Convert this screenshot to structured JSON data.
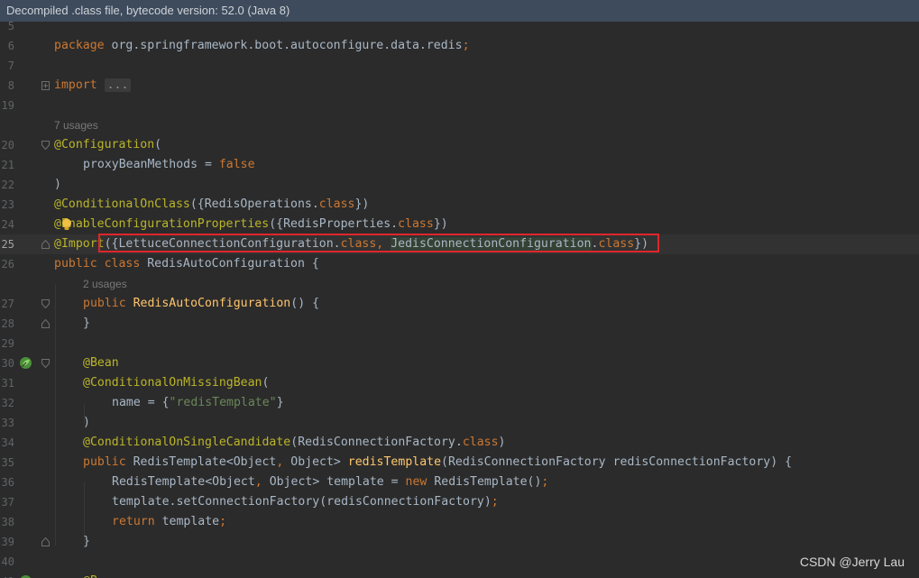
{
  "banner": {
    "text": "Decompiled .class file, bytecode version: 52.0 (Java 8)"
  },
  "editor": {
    "current_line": "25",
    "icons": {
      "fold": "fold-marker-icon",
      "intention": "lightbulb-icon",
      "bean": "spring-bean-icon"
    },
    "lines": [
      {
        "ln": "5"
      },
      {
        "ln": "6",
        "t1": "package",
        "t2": " org.springframework.boot.autoconfigure.data.redis",
        "t3": ";"
      },
      {
        "ln": "7"
      },
      {
        "ln": "8",
        "t1": "import",
        "t2": "..."
      },
      {
        "ln": "19"
      },
      {
        "usage": "7 usages"
      },
      {
        "ln": "20",
        "t1": "@Configuration",
        "t2": "("
      },
      {
        "ln": "21",
        "t1": "proxyBeanMethods = ",
        "t2": "false"
      },
      {
        "ln": "22",
        "t1": ")"
      },
      {
        "ln": "23",
        "t1": "@ConditionalOnClass",
        "t2": "({RedisOperations.",
        "t3": "class",
        "t4": "})"
      },
      {
        "ln": "24",
        "t1": "@EnableConfigurationProperties",
        "t2": "({RedisProperties.",
        "t3": "class",
        "t4": "})"
      },
      {
        "ln": "25",
        "t1": "@Import",
        "t2": "({LettuceConnectionConfiguration.",
        "t3": "class",
        "t4": ", ",
        "t5": "JedisConnectionConfiguration",
        "t6": ".",
        "t7": "class",
        "t8": "})"
      },
      {
        "ln": "26",
        "t1": "public class",
        "t2": " RedisAutoConfiguration {"
      },
      {
        "usage": "2 usages"
      },
      {
        "ln": "27",
        "t1": "public",
        "t2": " RedisAutoConfiguration",
        "t3": "() {"
      },
      {
        "ln": "28",
        "t1": "}"
      },
      {
        "ln": "29"
      },
      {
        "ln": "30",
        "t1": "@Bean"
      },
      {
        "ln": "31",
        "t1": "@ConditionalOnMissingBean",
        "t2": "("
      },
      {
        "ln": "32",
        "t1": "name = {",
        "t2": "\"redisTemplate\"",
        "t3": "}"
      },
      {
        "ln": "33",
        "t1": ")"
      },
      {
        "ln": "34",
        "t1": "@ConditionalOnSingleCandidate",
        "t2": "(RedisConnectionFactory.",
        "t3": "class",
        "t4": ")"
      },
      {
        "ln": "35",
        "t1": "public",
        "t2": " RedisTemplate<Object",
        "t3": ",",
        "t4": " Object> ",
        "t5": "redisTemplate",
        "t6": "(RedisConnectionFactory redisConnectionFactory) {"
      },
      {
        "ln": "36",
        "t1": "RedisTemplate<Object",
        "t2": ",",
        "t3": " Object> template = ",
        "t4": "new",
        "t5": " RedisTemplate()",
        "t6": ";"
      },
      {
        "ln": "37",
        "t1": "template.setConnectionFactory(redisConnectionFactory)",
        "t2": ";"
      },
      {
        "ln": "38",
        "t1": "return",
        "t2": " template",
        "t3": ";"
      },
      {
        "ln": "39",
        "t1": "}"
      },
      {
        "ln": "40"
      },
      {
        "ln": "41",
        "t1": "@B"
      }
    ]
  },
  "watermark": "CSDN @Jerry Lau"
}
